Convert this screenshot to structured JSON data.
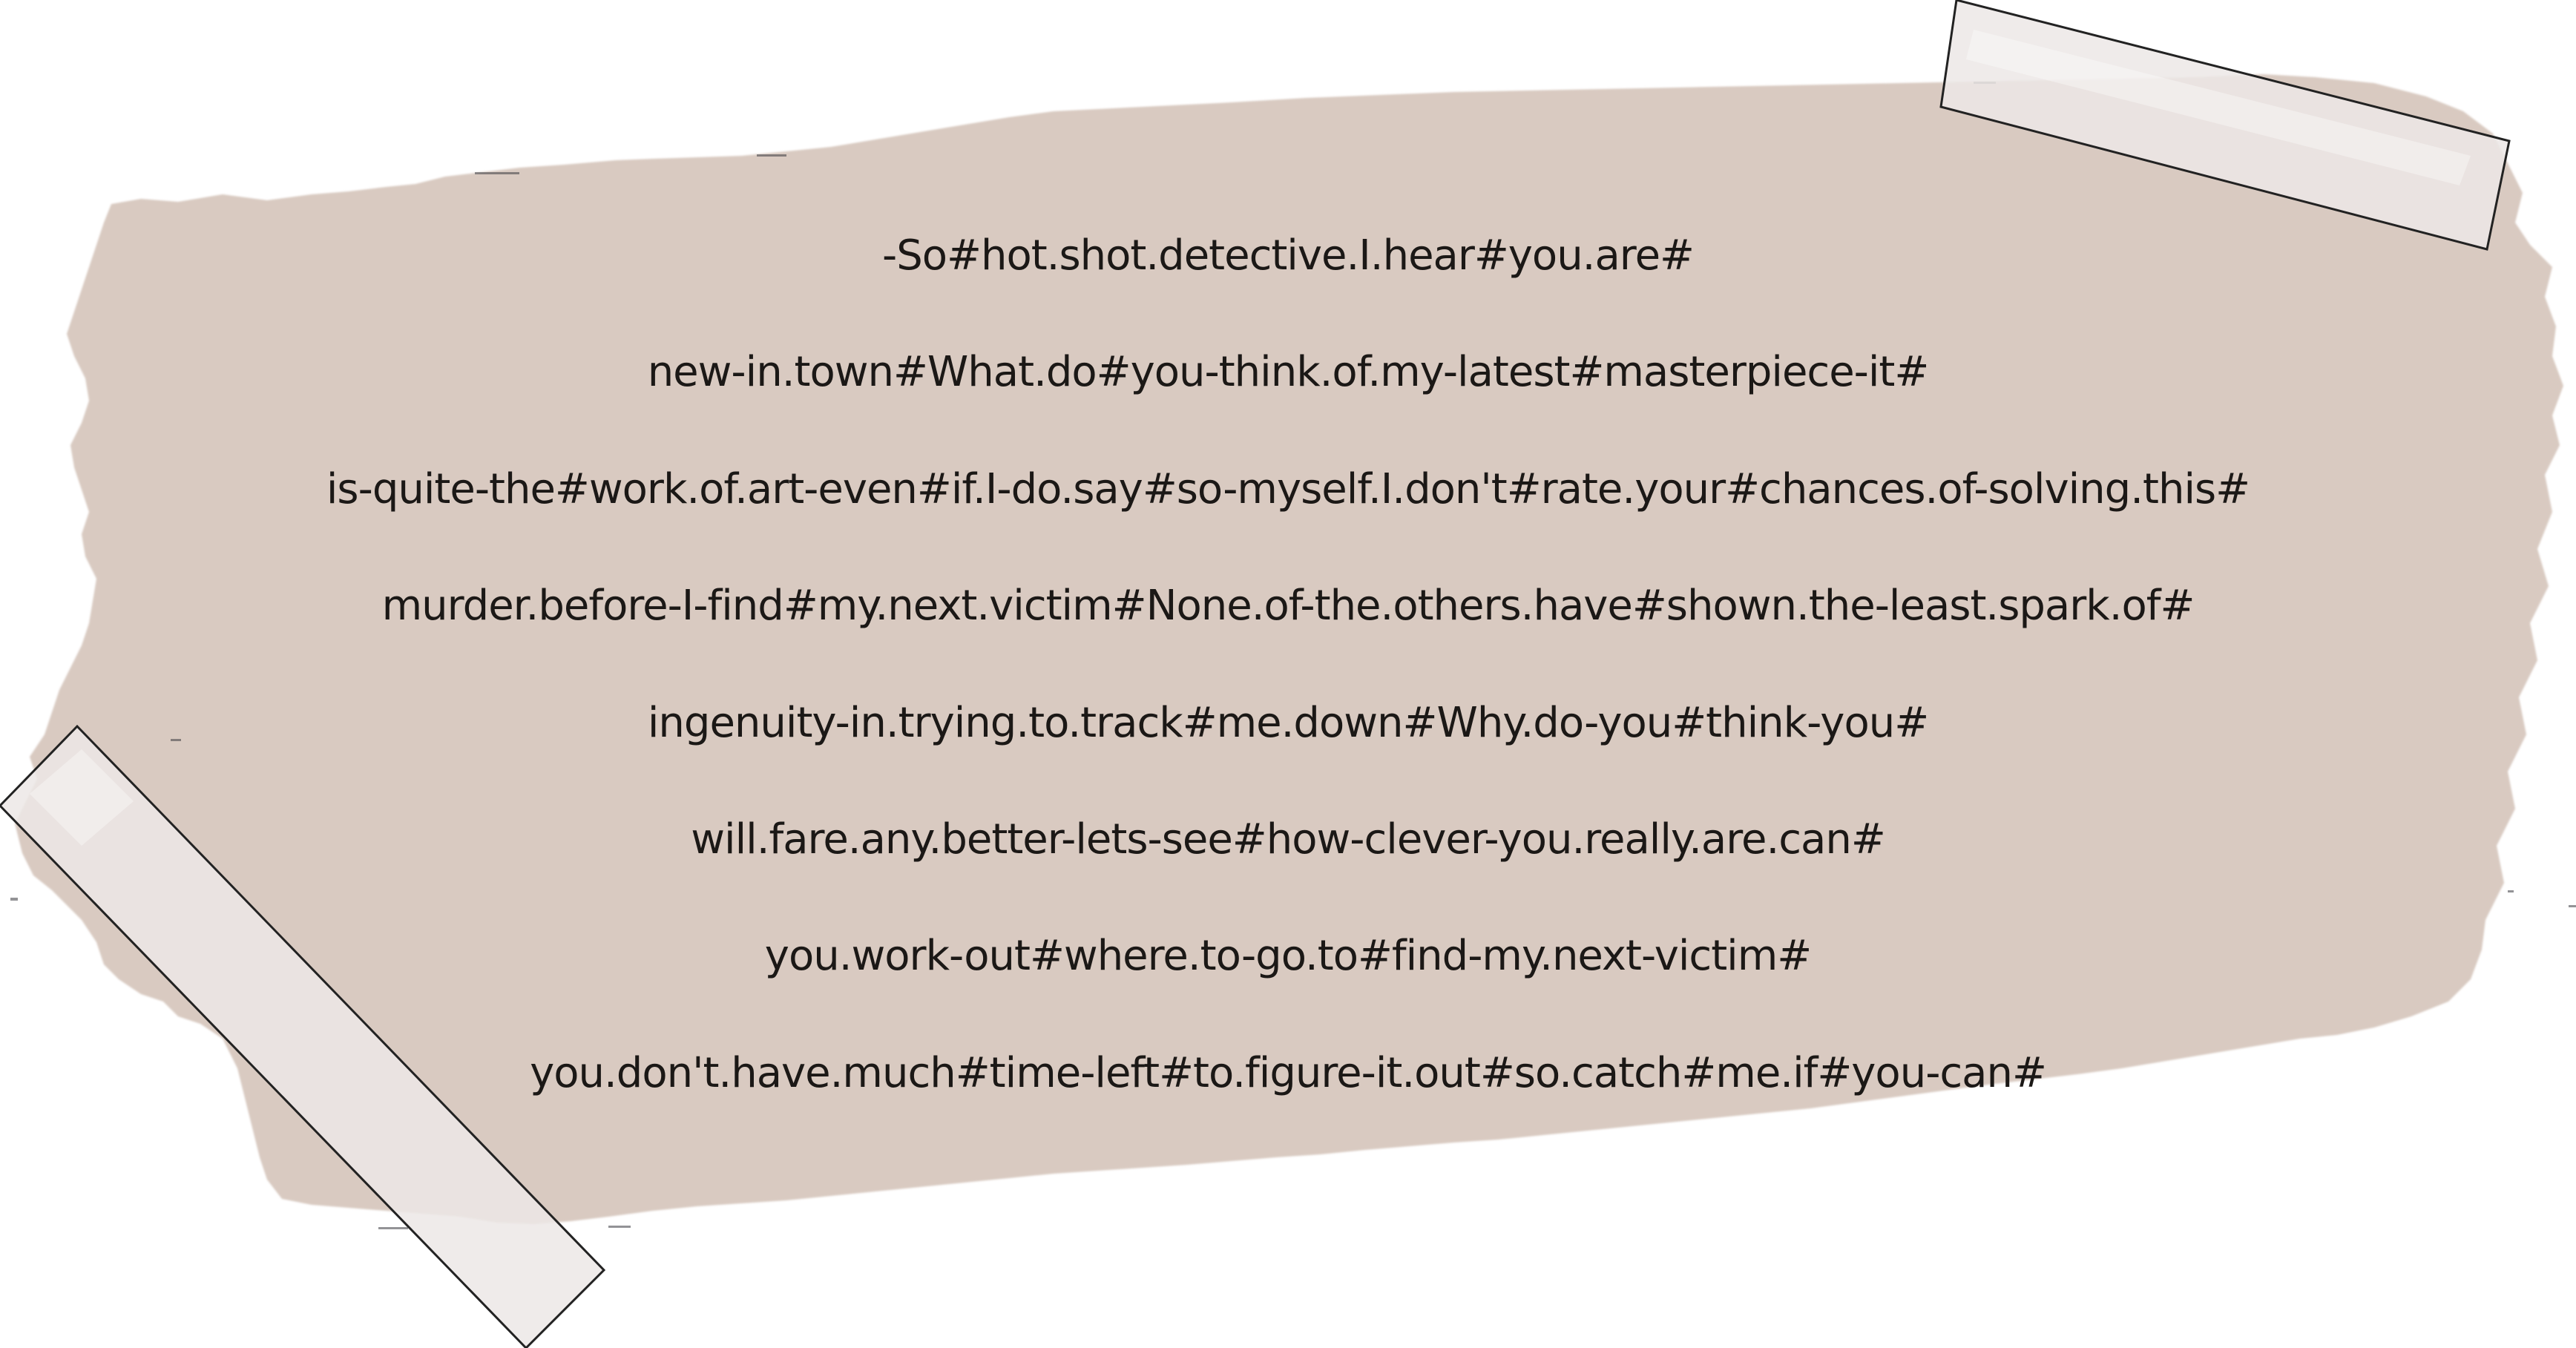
{
  "note": {
    "lines": [
      "-So#hot.shot.detective.I.hear#you.are#",
      "new-in.town#What.do#you-think.of.my-latest#masterpiece-it#",
      "is-quite-the#work.of.art-even#if.I-do.say#so-myself.I.don't#rate.your#chances.of-solving.this#",
      "murder.before-I-find#my.next.victim#None.of-the.others.have#shown.the-least.spark.of#",
      "ingenuity-in.trying.to.track#me.down#Why.do-you#think-you#",
      "will.fare.any.better-lets-see#how-clever-you.really.are.can#",
      "you.work-out#where.to-go.to#find-my.next-victim#",
      "you.don't.have.much#time-left#to.figure-it.out#so.catch#me.if#you-can#"
    ]
  },
  "colors": {
    "paper": "#d9cac1",
    "tape": "#ece8e6",
    "text": "#1b1816"
  }
}
